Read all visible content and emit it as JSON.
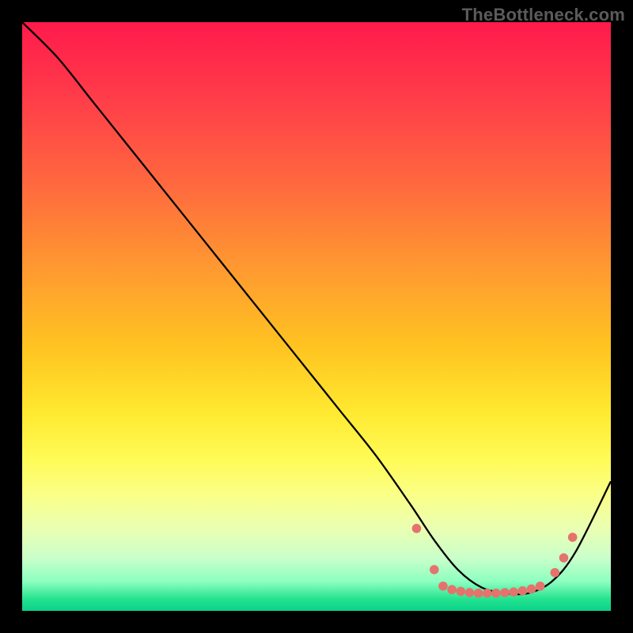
{
  "watermark": {
    "text": "TheBottleneck.com"
  },
  "chart_data": {
    "type": "line",
    "title": "",
    "xlabel": "",
    "ylabel": "",
    "xlim": [
      0,
      100
    ],
    "ylim": [
      0,
      100
    ],
    "grid": false,
    "series": [
      {
        "name": "curve",
        "x": [
          0,
          6,
          12,
          18,
          24,
          30,
          36,
          42,
          48,
          54,
          60,
          66,
          70,
          74,
          78,
          82,
          86,
          90,
          94,
          100
        ],
        "values": [
          100,
          94,
          86.5,
          79,
          71.5,
          64,
          56.5,
          49,
          41.5,
          34,
          26.5,
          18,
          12,
          7,
          4,
          3,
          3,
          5,
          10,
          22
        ],
        "color": "#000000",
        "line_width": 2.3
      }
    ],
    "markers": {
      "name": "dots",
      "color": "#e5736d",
      "radius": 5.8,
      "points": [
        {
          "x": 67,
          "y": 14
        },
        {
          "x": 70,
          "y": 7
        },
        {
          "x": 71.5,
          "y": 4.2
        },
        {
          "x": 73,
          "y": 3.6
        },
        {
          "x": 74.5,
          "y": 3.3
        },
        {
          "x": 76,
          "y": 3.1
        },
        {
          "x": 77.5,
          "y": 3.0
        },
        {
          "x": 79,
          "y": 3.0
        },
        {
          "x": 80.5,
          "y": 3.0
        },
        {
          "x": 82,
          "y": 3.1
        },
        {
          "x": 83.5,
          "y": 3.2
        },
        {
          "x": 85,
          "y": 3.4
        },
        {
          "x": 86.5,
          "y": 3.7
        },
        {
          "x": 88,
          "y": 4.2
        },
        {
          "x": 90.5,
          "y": 6.5
        },
        {
          "x": 92,
          "y": 9
        },
        {
          "x": 93.5,
          "y": 12.5
        }
      ]
    }
  }
}
